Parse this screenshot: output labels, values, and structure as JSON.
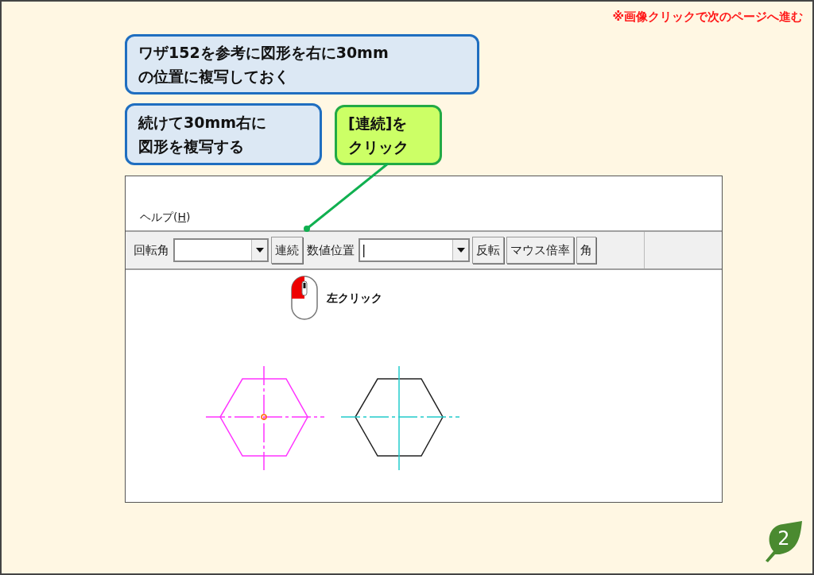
{
  "notice": "※画像クリックで次のページへ進む",
  "callouts": [
    {
      "kind": "info",
      "lines": [
        "ワザ152を参考に図形を右に30mm",
        "の位置に複写しておく"
      ]
    },
    {
      "kind": "info",
      "lines": [
        "続けて30mm右に",
        "図形を複写する"
      ]
    },
    {
      "kind": "action",
      "lines": [
        "[連続]を",
        "クリック"
      ]
    }
  ],
  "menu": {
    "label": "ヘルプ(H)"
  },
  "toolbar": [
    {
      "kind": "label",
      "text": "回転角"
    },
    {
      "kind": "combo"
    },
    {
      "kind": "button",
      "text": "連続"
    },
    {
      "kind": "label",
      "text": "数値位置"
    },
    {
      "kind": "combo",
      "value": "|"
    },
    {
      "kind": "button",
      "text": "反転"
    },
    {
      "kind": "button",
      "text": "マウス倍率"
    },
    {
      "kind": "button",
      "text": "角"
    }
  ],
  "mouse_hint": "左クリック",
  "page_number": "2"
}
